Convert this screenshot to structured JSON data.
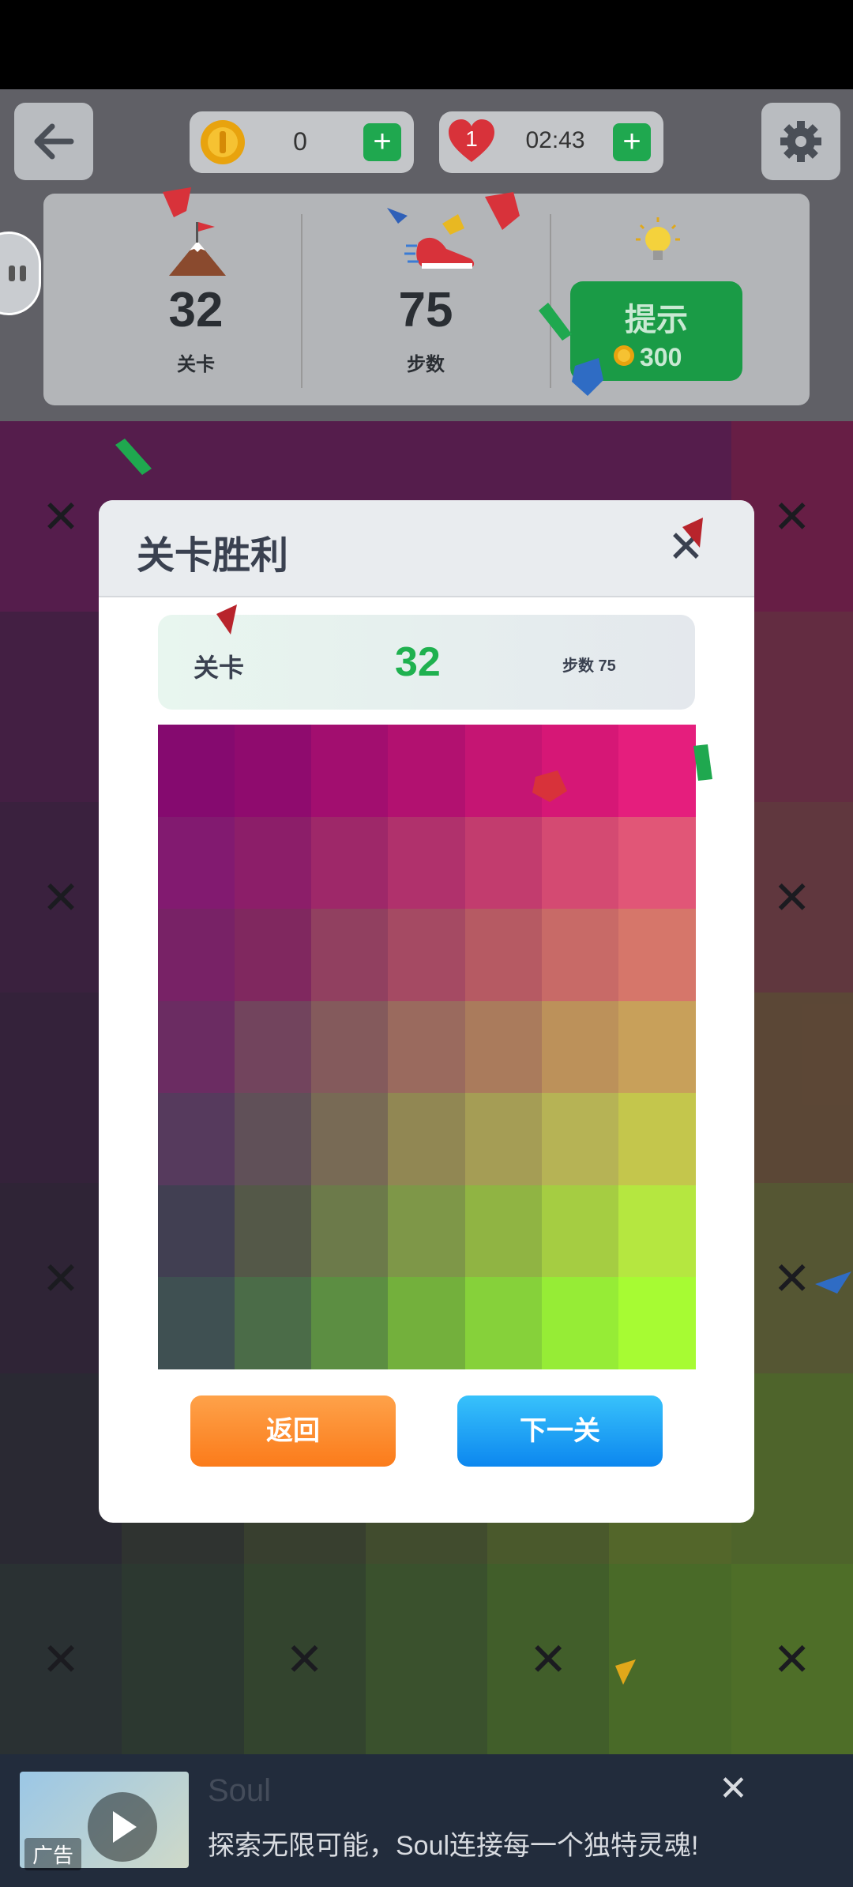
{
  "header": {
    "coins": "0",
    "lives": "1",
    "timer": "02:43"
  },
  "stats": {
    "level_value": "32",
    "level_label": "关卡",
    "steps_value": "75",
    "steps_label": "步数",
    "hint_label": "提示",
    "hint_cost": "300"
  },
  "dialog": {
    "title": "关卡胜利",
    "info_level_label": "关卡",
    "info_level_value": "32",
    "info_steps": "步数 75",
    "back_label": "返回",
    "next_label": "下一关"
  },
  "ad": {
    "title": "Soul",
    "text": "探索无限可能，Soul连接每一个独特灵魂!",
    "badge": "广告"
  },
  "icons": {
    "back": "arrow-left-icon",
    "coin": "coin-icon",
    "heart": "heart-icon",
    "settings": "gear-icon",
    "mountain": "mountain-flag-icon",
    "shoe": "sneaker-icon",
    "bulb": "lightbulb-icon",
    "close": "close-icon",
    "play": "play-icon"
  },
  "colors": {
    "accent_green": "#1fa84f",
    "level_green": "#1fb14f",
    "back_orange": "#fb8a24",
    "next_blue": "#1a9ef5"
  },
  "palette_colors": [
    [
      "#850a6f",
      "#8f0b6e",
      "#a20e6f",
      "#b21170",
      "#c51573",
      "#d61776",
      "#e51e7d"
    ],
    [
      "#821a70",
      "#8c1e69",
      "#9e2869",
      "#b0316c",
      "#c23c6e",
      "#d44a72",
      "#e15677"
    ],
    [
      "#782266",
      "#80285f",
      "#914060",
      "#a54a63",
      "#b65a63",
      "#c86a67",
      "#d6766a"
    ],
    [
      "#6b2c62",
      "#72445d",
      "#845a5c",
      "#9a6a5e",
      "#aa7b5c",
      "#bc915a",
      "#c8a05a"
    ],
    [
      "#563a5d",
      "#605058",
      "#786a55",
      "#918753",
      "#a59d55",
      "#b6b355",
      "#c4c64c"
    ],
    [
      "#413f52",
      "#545848",
      "#6c7a4a",
      "#7e9748",
      "#90b443",
      "#a5cd42",
      "#b5e740"
    ],
    [
      "#3f5052",
      "#4b6c48",
      "#5c8e42",
      "#73b03c",
      "#86d13a",
      "#96ec36",
      "#a7fb33"
    ]
  ],
  "grid_colors": [
    [
      "#7a1561",
      "#7a1561",
      "#7a1561",
      "#7a1561",
      "#7a1561",
      "#7a1561",
      "#9b1755"
    ],
    [
      "#5a1850",
      "#6a1a55",
      "#801d5b",
      "#902460",
      "#a02a5e",
      "#b03058",
      "#94304d"
    ],
    [
      "#4a1c48",
      "#5b2046",
      "#6b2a48",
      "#7d3449",
      "#8e3e49",
      "#9a4646",
      "#8e4448"
    ],
    [
      "#3e1e40",
      "#4a2a40",
      "#5a3a40",
      "#6a4a40",
      "#7a5a3f",
      "#8a6a3c",
      "#86613a"
    ],
    [
      "#35223a",
      "#403036",
      "#504436",
      "#625836",
      "#726c34",
      "#847e30",
      "#7b7d33"
    ],
    [
      "#2c2a34",
      "#353d2f",
      "#46522c",
      "#566a2b",
      "#668227",
      "#779a24",
      "#6e9526"
    ],
    [
      "#2c3a33",
      "#30462f",
      "#3c5c2a",
      "#4a7428",
      "#568a24",
      "#64a020",
      "#6ea820"
    ]
  ]
}
